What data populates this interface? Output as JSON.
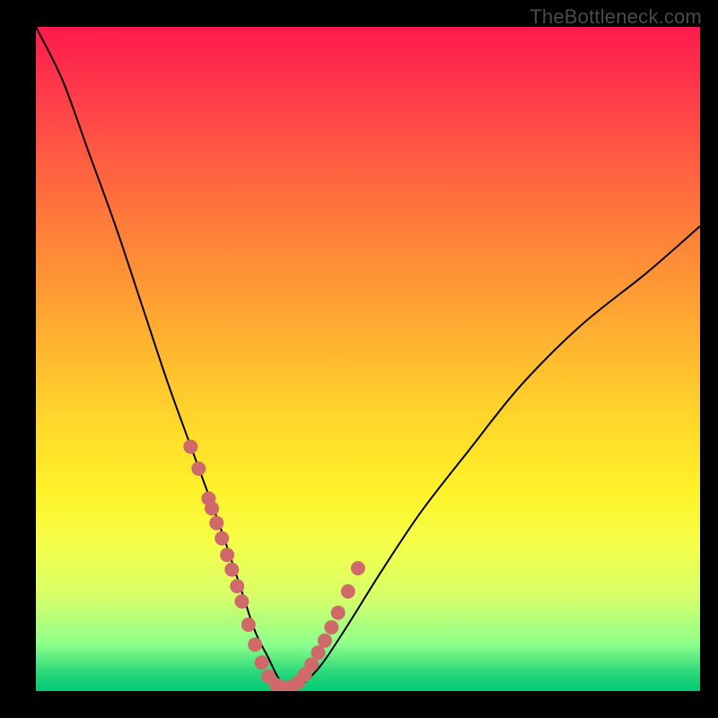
{
  "watermark": "TheBottleneck.com",
  "chart_data": {
    "type": "line",
    "title": "",
    "xlabel": "",
    "ylabel": "",
    "xlim": [
      0,
      100
    ],
    "ylim": [
      0,
      100
    ],
    "grid": false,
    "series": [
      {
        "name": "bottleneck-curve",
        "x": [
          0,
          4,
          8,
          12,
          16,
          20,
          24,
          28,
          31,
          33,
          35,
          36.5,
          38,
          40,
          43,
          47,
          52,
          58,
          65,
          73,
          82,
          92,
          100
        ],
        "y": [
          100,
          92,
          81,
          70,
          58,
          46,
          35,
          24,
          15,
          9,
          5,
          2,
          0.5,
          1,
          4,
          10,
          18,
          27,
          36,
          46,
          55,
          63,
          70
        ],
        "stroke": "#000000",
        "stroke_width": 2
      }
    ],
    "markers": {
      "name": "highlight-dots",
      "x": [
        23.3,
        24.5,
        26,
        26.5,
        27.2,
        28,
        28.8,
        29.5,
        30.3,
        31,
        32,
        33,
        34,
        35,
        36.2,
        37.5,
        38.5,
        39.5,
        40.5,
        41.5,
        42.5,
        43.5,
        44.5,
        45.5,
        47,
        48.5
      ],
      "y": [
        36.8,
        33.5,
        29,
        27.5,
        25.3,
        23,
        20.5,
        18.3,
        15.8,
        13.5,
        10,
        7,
        4.3,
        2.2,
        0.9,
        0.5,
        0.6,
        1.3,
        2.5,
        4,
        5.8,
        7.6,
        9.6,
        11.8,
        15,
        18.5
      ],
      "color": "#d06a6a",
      "radius": 8
    },
    "background_gradient": {
      "top": "#ff1a4d",
      "mid": "#ffd92a",
      "bottom": "#00c974"
    }
  }
}
